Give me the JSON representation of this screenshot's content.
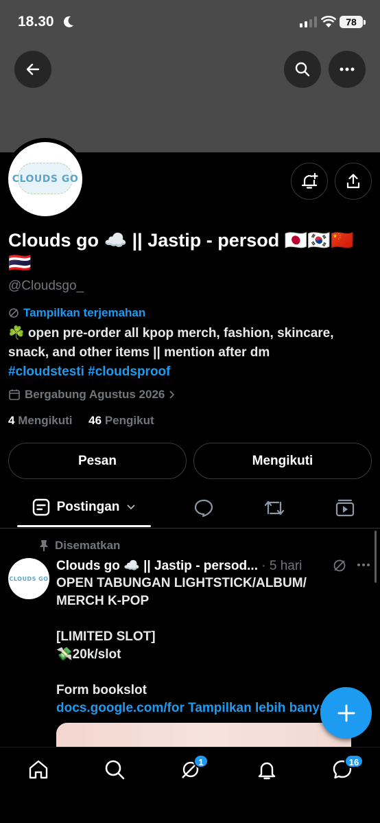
{
  "status_bar": {
    "time": "18.30",
    "battery": "78"
  },
  "profile": {
    "display_name": "Clouds go ☁️ || Jastip - persod 🇯🇵🇰🇷🇨🇳 🇹🇭",
    "handle": "@Cloudsgo_",
    "avatar_text": "CLOUDS GO",
    "translate_label": "Tampilkan terjemahan",
    "bio": "☘️ open pre-order all kpop merch, fashion, skincare, snack, and other items || mention after dm",
    "bio_tags": "#cloudstesti #cloudsproof",
    "joined": "Bergabung Agustus 2026",
    "following_count": "4",
    "following_label": "Mengikuti",
    "followers_count": "46",
    "followers_label": "Pengikut"
  },
  "actions": {
    "message_label": "Pesan",
    "following_label": "Mengikuti"
  },
  "tabs": {
    "active_label": "Postingan"
  },
  "pinned_post": {
    "pinned_label": "Disematkan",
    "author": "Clouds go ☁️ || Jastip - persod...",
    "time": "· 5 hari",
    "line1": "OPEN TABUNGAN LIGHTSTICK/ALBUM/ MERCH K-POP",
    "line2": "[LIMITED SLOT]",
    "line3": "💸20k/slot",
    "line4": "Form bookslot",
    "link": "docs.google.com/for",
    "show_more": "Tampilkan lebih banyak"
  },
  "bottom_nav": {
    "grok_badge": "1",
    "messages_badge": "16"
  },
  "colors": {
    "accent": "#1d9bf0",
    "background": "#000000",
    "banner": "#4a4a4a"
  }
}
